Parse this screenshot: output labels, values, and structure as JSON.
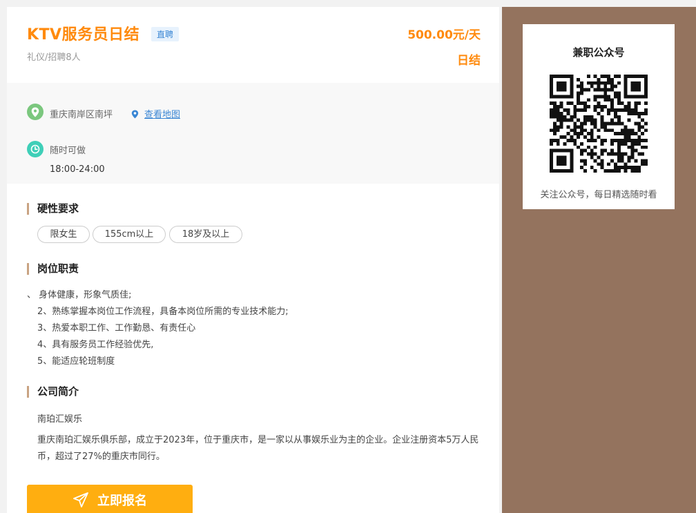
{
  "job": {
    "title": "KTV服务员日结",
    "badge": "直聘",
    "subtitle": "礼仪/招聘8人",
    "salary": "500.00元/天",
    "settlement": "日结"
  },
  "info": {
    "address": "重庆南岸区南坪",
    "map_link": "查看地图",
    "time_label": "随时可做",
    "time_range": "18:00-24:00"
  },
  "requirements": {
    "heading": "硬性要求",
    "tags": [
      "限女生",
      "155cm以上",
      "18岁及以上"
    ]
  },
  "duties": {
    "heading": "岗位职责",
    "items": [
      "、 身体健康，形象气质佳;",
      "2、熟练掌握本岗位工作流程，具备本岗位所需的专业技术能力;",
      "3、热爱本职工作、工作勤恳、有责任心",
      "4、具有服务员工作经验优先,",
      "5、能适应轮班制度"
    ]
  },
  "company": {
    "heading": "公司简介",
    "name": "南珀汇娱乐",
    "description": "重庆南珀汇娱乐俱乐部，成立于2023年，位于重庆市，是一家以从事娱乐业为主的企业。企业注册资本5万人民币，超过了27%的重庆市同行。"
  },
  "apply": {
    "label": "立即报名"
  },
  "sidebar": {
    "qr_title": "兼职公众号",
    "qr_caption": "关注公众号，每日精选随时看"
  },
  "colors": {
    "accent": "#ff8a0d",
    "button": "#ffae10",
    "sidebar_bg": "#94735e",
    "link": "#3a86d4"
  },
  "icons": [
    "location-icon",
    "map-pin-icon",
    "clock-icon",
    "paper-plane-icon",
    "qr-code"
  ]
}
